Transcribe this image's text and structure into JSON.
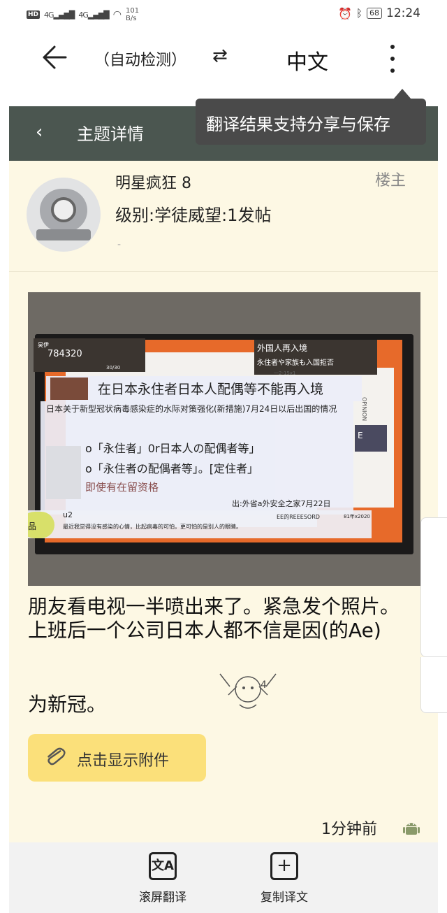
{
  "status_bar": {
    "hd": "HD",
    "net1": "4G",
    "net2": "4G",
    "speed_value": "101",
    "speed_unit": "B/s",
    "battery": "68",
    "time": "12:24"
  },
  "translate_bar": {
    "source_lang": "（自动检测）",
    "target_lang": "中文",
    "tooltip": "翻译结果支持分享与保存"
  },
  "app_header": {
    "title": "主题详情"
  },
  "post": {
    "username": "明星疯狂 8",
    "user_meta": "级别:学徒威望:1发帖",
    "user_extra": "-",
    "owner_badge": "楼主",
    "photo": {
      "tl_label": "昊伊",
      "tl_number": "784320",
      "tl_small": "30/30",
      "tr_title": "外国人再入境",
      "tr_sub": "永住者や家族も入国拒否",
      "tr_small": "一2-15x1",
      "headline": "在日本永住者日本人配偶等不能再入境",
      "subhead": "日本关于新型冠状病毒感染症的水际对策强化(新措施)7月24日以后出国的情况",
      "item1": "o「永住者」0r日本人の配偶者等」",
      "item2": "o「永住者の配偶者等」。[定住者」",
      "note": "即使有在留资格",
      "source": "出:外省a外安全之家7月22日",
      "ticker_left": "品",
      "u2": "u2",
      "ticker": "最近我觉得没有感染的心情，比起病毒的可怕，更可怕的是别人的眼睛。",
      "ticker_brand": "EE的REEESORD",
      "ticker_date": "81年x2020",
      "side_e": "E",
      "side_opinion": "OPINION"
    },
    "text_line1": "朋友看电视一半喷出来了。紧急发个照片。",
    "text_line2": "上班后一个公司日本人都不信是因(的Ae)",
    "text_line3": "为新冠。",
    "sticker_text": "4",
    "attach_label": "点击显示附件",
    "time_ago": "1分钟前"
  },
  "bottom_bar": {
    "scroll_translate": "滚屏翻译",
    "copy_translation": "复制译文"
  },
  "icons": {
    "back": "back-arrow-icon",
    "swap": "swap-icon",
    "more": "more-vertical-icon",
    "attach": "paperclip-icon",
    "android": "android-icon",
    "scroll_translate": "scroll-translate-icon",
    "copy": "copy-icon"
  },
  "colors": {
    "header": "#4b5650",
    "post_bg": "#fdf8e4",
    "attach_btn": "#fbe07a",
    "tooltip": "#4a4a4a"
  }
}
